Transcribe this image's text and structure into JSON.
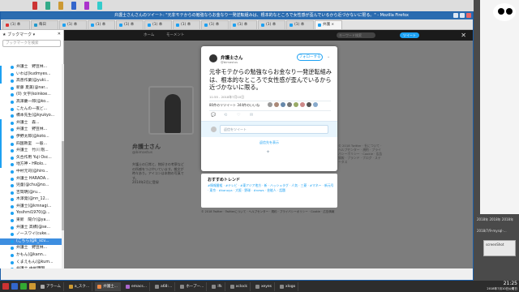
{
  "window": {
    "title": "弁護士さんさんのツイート: \"元非モテからの勉強ならお金なり一発逆転組みは、根本的なところで女性感が歪んでいるから近づかないに限る。\" - Mozilla Firefox"
  },
  "tabs": [
    {
      "label": "(1) 本"
    },
    {
      "label": "毎日"
    },
    {
      "label": "(1) 本"
    },
    {
      "label": "(1) 本"
    },
    {
      "label": "(1) 本"
    },
    {
      "label": "(1) 本"
    },
    {
      "label": "(1) 本"
    },
    {
      "label": "(1) 本"
    },
    {
      "label": "(1) 本"
    },
    {
      "label": "(1) 本"
    },
    {
      "label": "(1) 本"
    },
    {
      "label": "弁護 ×"
    }
  ],
  "nav": {
    "url_org": "Twitter, Inc (US)",
    "url_path": "https://twitter.com/bimastus/status/1016479898942828633",
    "search_placeholder": "検索"
  },
  "sidebar": {
    "title": "ブックマーク",
    "search_placeholder": "ブックマークを検索",
    "items": [
      "弁護士　野豆林...",
      "いわば(kudmyes...",
      "高善作業(@yuki...",
      "新藤 夏美(@nar...",
      "(0) 文字(koinkoe...",
      "高澤慶一郎(@ko...",
      "こたんの一夜ど...",
      "橋本先生(@kyukyo...",
      "弁護士　森...",
      "弁護士　野豆林...",
      "伊野太郎(@koto...",
      "四国教室　一般...",
      "弁護士　竹川 剛...",
      "矢合作用 Yuji Osc...",
      "地方神・HRolo...",
      "中村元司(@hiro...",
      "弁護士 HARADA...",
      "児童(@chu@no...",
      "吉岡明(@ru...",
      "木澤発(@nn_12...",
      "弁護士(@kmnagi...",
      "Yosihmi1970(@...",
      "東新　陽介(@ya...",
      "弁護士 高橋(@se...",
      "ノ一スワイ(cuke...",
      "(こちら)@k_scv...",
      "弁護士　野豆林...",
      "かもん(@kann...",
      "くまえもん(@kum...",
      "弁護士 中村康明...",
      "弁護士 亀石倫子...",
      "ぬるぐ(@pgluglo...",
      "山口寿士 okuye...",
      "弁護士 佐野正好..."
    ],
    "selected_index": 25
  },
  "twitter": {
    "nav_home": "ホーム",
    "nav_moments": "モーメント",
    "search_placeholder": "キーワード検索",
    "tweet_button": "ツイート",
    "profile_name": "弁護士さん",
    "profile_handle": "@bimastus",
    "profile_bio": "弁護士の日常と、物好きの考察などの所感をつぶやいています。雑文が時々あり。アイコンは本物の写真です。",
    "profile_joined": "2014年2月に登録",
    "right_info": "© 2018 Twitter · 社について · ヘルプセンター · 規約 · プライバシーポリシー · Cookie · 広告情報 · ブランド · ブログ · ステータス"
  },
  "tweet": {
    "name": "弁護士さん",
    "handle": "@bimastus",
    "follow_label": "フォローする",
    "text": "元非モテからの勉強ならお金なり一発逆転組みは、根本的なところで女性感が歪んでいるから近づかないに限る。",
    "time": "11:55 - 2018年7月10日",
    "stats": "80件のリツイート 344件のいいね",
    "reply_placeholder": "返信をツイート",
    "login_link": "返信先を表示",
    "logo": "✦"
  },
  "trends": {
    "title": "おすすめトレンド",
    "body": "#情報番組 · #テレビ · #東アジア地方 · 新 · ハッシュタグ · 人気 · 三菱 · #マネー · 新元号 · 東京 · #kanoya · 大阪 · 野球 · #news · 芸能人 · 話題"
  },
  "footer": {
    "text": "© 2018 Twitter · Twitterについて · ヘルプセンター · 規約 · プライバシーポリシー · Cookie · 広告情報"
  },
  "right_desk": {
    "label1": "2018年 2018年 2018年",
    "label2": "2018/7/9-mysql-...",
    "box_label": "screenShot"
  },
  "taskbar": {
    "items": [
      "アラーム",
      "a_スク...",
      "弁護士...",
      "emacs...",
      "a68:...",
      "ホープー...",
      "ifk",
      "xclock",
      "xeyes",
      "xlogo"
    ],
    "clock_time": "21:25",
    "clock_date": "2018年7月10日火曜日"
  },
  "colors": {
    "twitter_blue": "#1da1f2",
    "titlebar": "#2b6cb0",
    "sidebar_selected": "#3d8ee0"
  }
}
